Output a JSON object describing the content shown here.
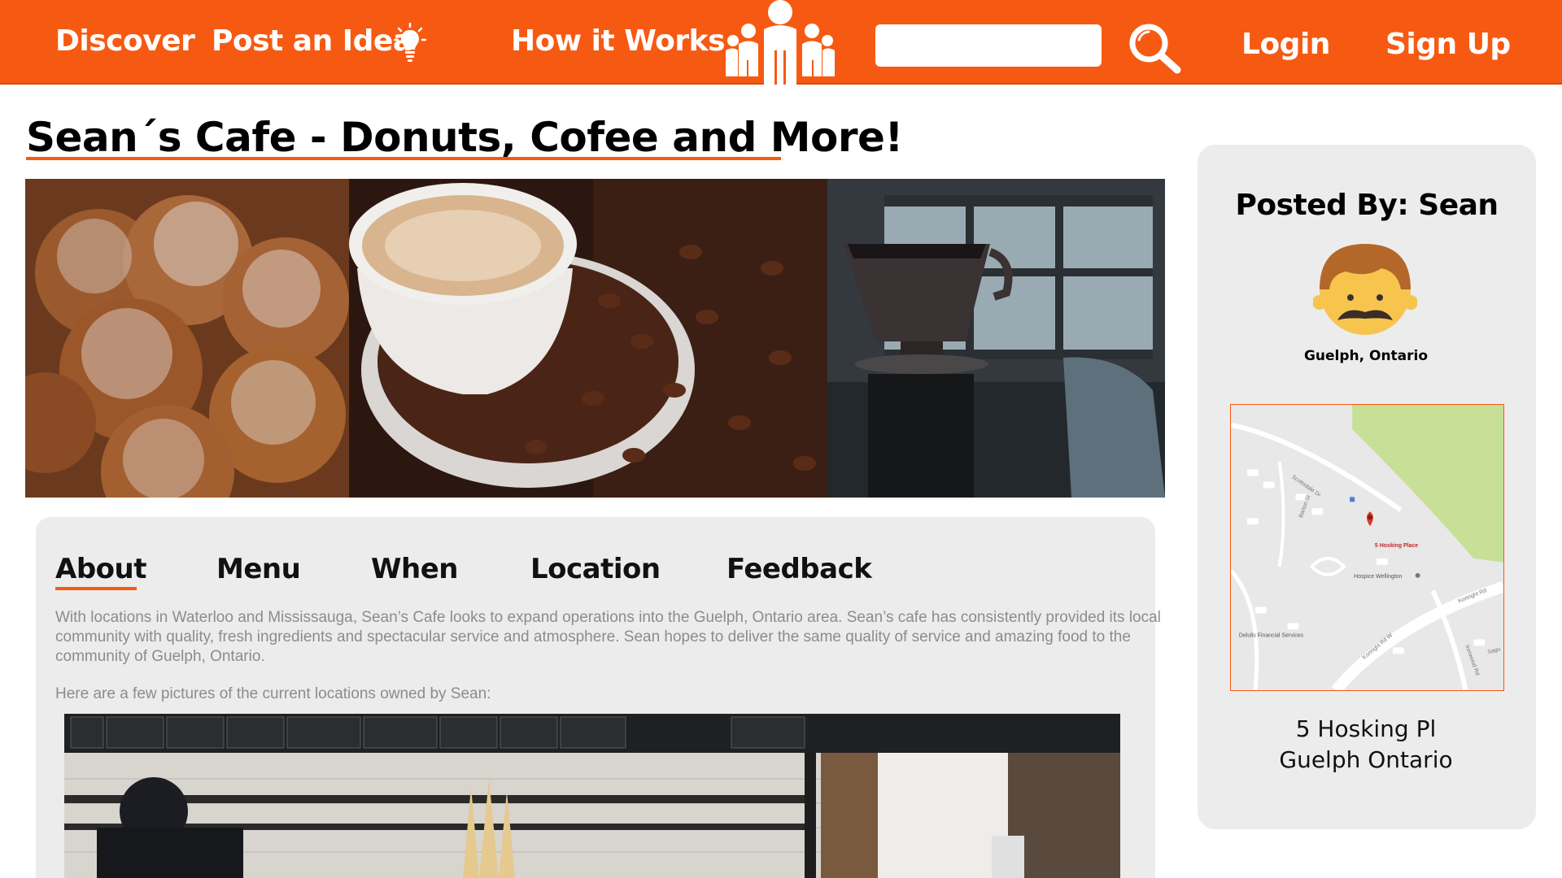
{
  "header": {
    "nav": {
      "discover": "Discover",
      "post_idea": "Post an Idea",
      "how_it_works": "How it Works",
      "login": "Login",
      "signup": "Sign Up"
    },
    "search": {
      "value": "",
      "placeholder": ""
    },
    "icons": {
      "idea": "lightbulb-icon",
      "logo": "people-group-logo",
      "search": "magnifier-icon"
    }
  },
  "page": {
    "title": "Sean´s Cafe - Donuts, Cofee and More!"
  },
  "tabs": [
    {
      "label": "About",
      "active": true
    },
    {
      "label": "Menu",
      "active": false
    },
    {
      "label": "When",
      "active": false
    },
    {
      "label": "Location",
      "active": false
    },
    {
      "label": "Feedback",
      "active": false
    }
  ],
  "about": {
    "body": "With locations in Waterloo and Mississauga, Sean’s Cafe looks to expand operations into the Guelph, Ontario area. Sean’s cafe has consistently provided its local community with quality, fresh ingredients and spectacular service and atmosphere. Sean hopes to deliver the same quality of service and amazing food to the community of Guelph, Ontario.",
    "intro": "Here are a few pictures of the current locations owned by Sean:"
  },
  "sidebar": {
    "posted_by": "Posted By:  Sean",
    "user_location": "Guelph, Ontario",
    "address_line1": "5 Hosking Pl",
    "address_line2": "Guelph Ontario",
    "map": {
      "marker_label": "5 Hosking Place",
      "poi_1": "Hospice Wellington",
      "poi_2": "Delulis Financial Services",
      "streets": [
        "Scottsdale Dr",
        "Barton St",
        "Kortright Rd",
        "Kortright Rd W",
        "Ironwood Rd",
        "Sagu"
      ]
    }
  },
  "colors": {
    "brand_orange": "#f65a12",
    "panel_gray": "#ececec",
    "body_text_gray": "#8c8c8c",
    "map_park_green": "#c8df98"
  }
}
